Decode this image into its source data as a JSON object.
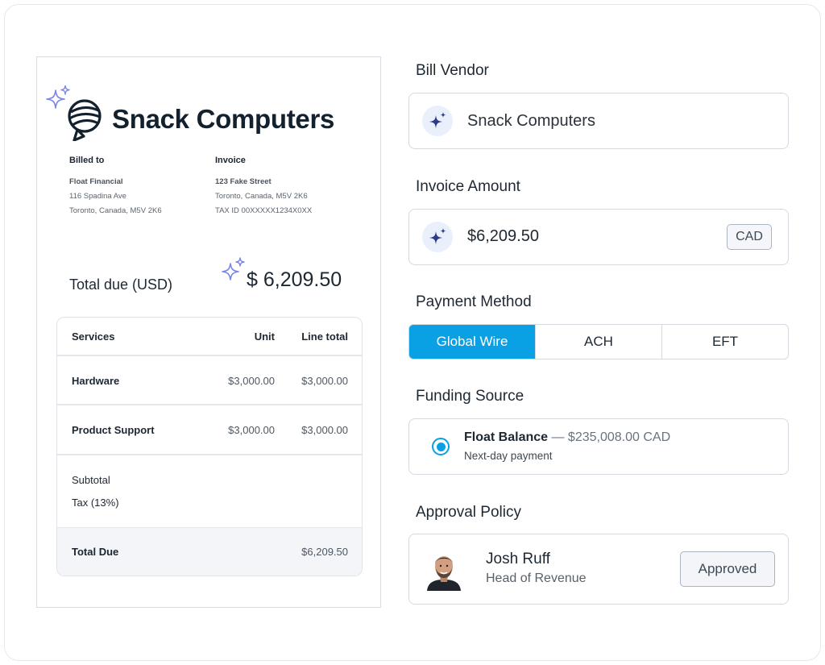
{
  "invoice": {
    "brand_name": "Snack Computers",
    "billed_to": {
      "heading": "Billed to",
      "name": "Float Financial",
      "line1": "116 Spadina Ave",
      "line2": "Toronto, Canada, M5V 2K6"
    },
    "from": {
      "heading": "Invoice",
      "name": "123 Fake Street",
      "line1": "Toronto, Canada, M5V 2K6",
      "line2": "TAX ID 00XXXXX1234X0XX"
    },
    "total_due_label": "Total due (USD)",
    "total_due_value": "$ 6,209.50",
    "table": {
      "headers": {
        "service": "Services",
        "unit": "Unit",
        "line_total": "Line total"
      },
      "rows": [
        {
          "service": "Hardware",
          "unit": "$3,000.00",
          "line_total": "$3,000.00"
        },
        {
          "service": "Product Support",
          "unit": "$3,000.00",
          "line_total": "$3,000.00"
        }
      ],
      "subtotal_label": "Subtotal",
      "tax_label": "Tax (13%)",
      "total_label": "Total Due",
      "total_value": "$6,209.50"
    }
  },
  "form": {
    "bill_vendor": {
      "label": "Bill Vendor",
      "value": "Snack Computers",
      "icon": "sparkle-icon"
    },
    "invoice_amount": {
      "label": "Invoice Amount",
      "value": "$6,209.50",
      "currency": "CAD",
      "icon": "sparkle-icon"
    },
    "payment_method": {
      "label": "Payment Method",
      "options": [
        "Global Wire",
        "ACH",
        "EFT"
      ],
      "selected": "Global Wire"
    },
    "funding_source": {
      "label": "Funding Source",
      "name": "Float Balance",
      "balance": " — $235,008.00 CAD",
      "sub": "Next-day payment",
      "selected": true
    },
    "approval_policy": {
      "label": "Approval Policy",
      "person_name": "Josh Ruff",
      "person_role": "Head of Revenue",
      "status": "Approved"
    }
  },
  "colors": {
    "accent": "#0aa0e4",
    "sparkle": "#7a86e6",
    "sparkle_dark": "#2c3a8c",
    "text_dark": "#13202e"
  }
}
